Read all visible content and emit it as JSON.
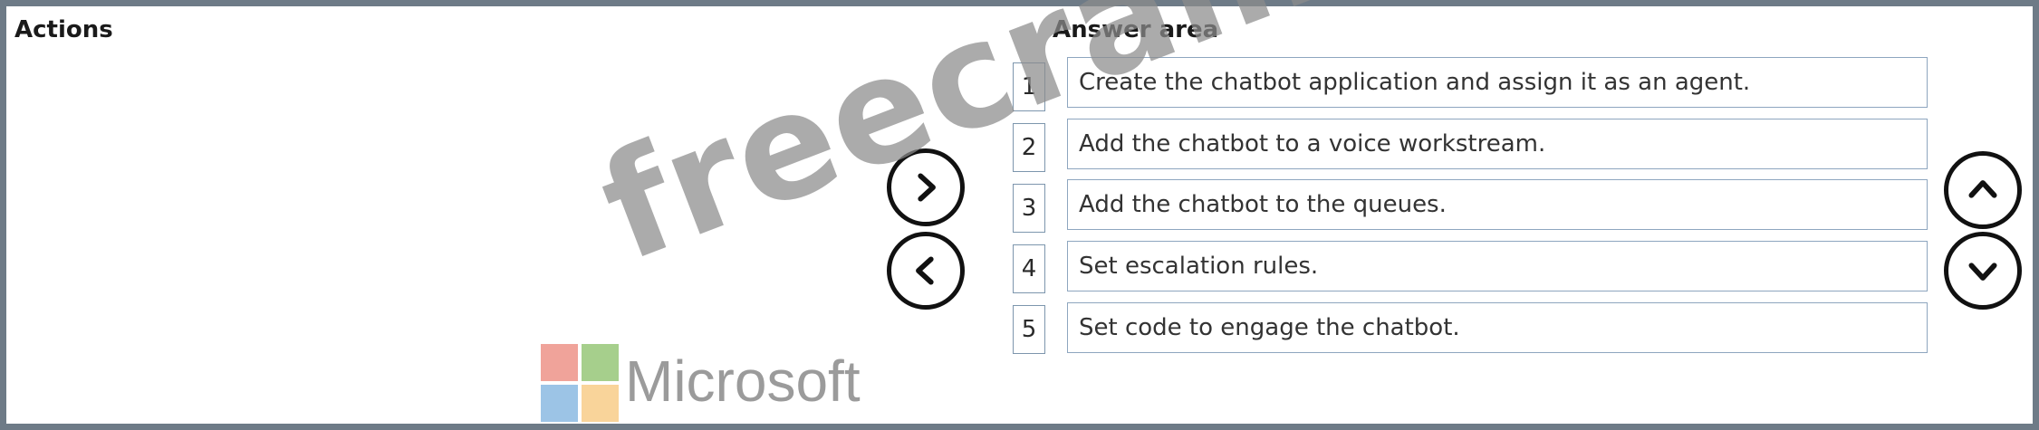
{
  "actions": {
    "title": "Actions"
  },
  "answer_area": {
    "title": "Answer area",
    "items": [
      {
        "number": "1",
        "text": "Create the chatbot application and assign it as an agent."
      },
      {
        "number": "2",
        "text": "Add the chatbot to a voice workstream."
      },
      {
        "number": "3",
        "text": "Add the chatbot to the queues."
      },
      {
        "number": "4",
        "text": "Set escalation rules."
      },
      {
        "number": "5",
        "text": "Set code to engage the chatbot."
      }
    ]
  },
  "controls": {
    "move_right_icon": "chevron-right-icon",
    "move_left_icon": "chevron-left-icon",
    "move_up_icon": "chevron-up-icon",
    "move_down_icon": "chevron-down-icon"
  },
  "branding": {
    "logo_text": "Microsoft",
    "watermark": "freecram.net",
    "logo_colors": [
      "#f0a39a",
      "#a6cf8c",
      "#9cc4e6",
      "#f9d49a"
    ]
  },
  "colors": {
    "frame": "#6e7b87",
    "box_border": "#8ea6bf"
  }
}
